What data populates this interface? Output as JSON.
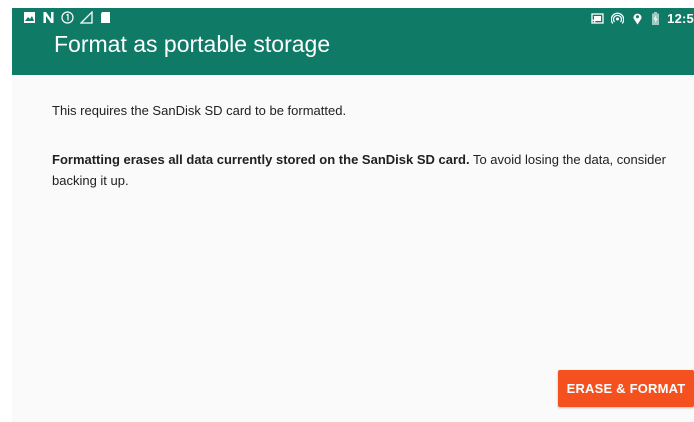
{
  "colors": {
    "appbar": "#0f7b67",
    "accent_button": "#f4511e",
    "text": "#212121",
    "background": "#fafafa"
  },
  "status_bar": {
    "left_icons": [
      "image-notification-icon",
      "n-notification-icon",
      "number-one-badge-icon",
      "signal-outline-icon",
      "sd-card-icon"
    ],
    "right_icons": [
      "cast-icon",
      "hotspot-icon",
      "location-icon",
      "battery-charging-icon"
    ],
    "clock": "12:5"
  },
  "header": {
    "title": "Format as portable storage"
  },
  "body": {
    "paragraph_1": "This requires the SanDisk SD card to be formatted.",
    "paragraph_2_bold": "Formatting erases all data currently stored on the SanDisk SD card.",
    "paragraph_2_rest": " To avoid losing the data, consider backing it up."
  },
  "actions": {
    "erase_format_label": "ERASE & FORMAT"
  }
}
